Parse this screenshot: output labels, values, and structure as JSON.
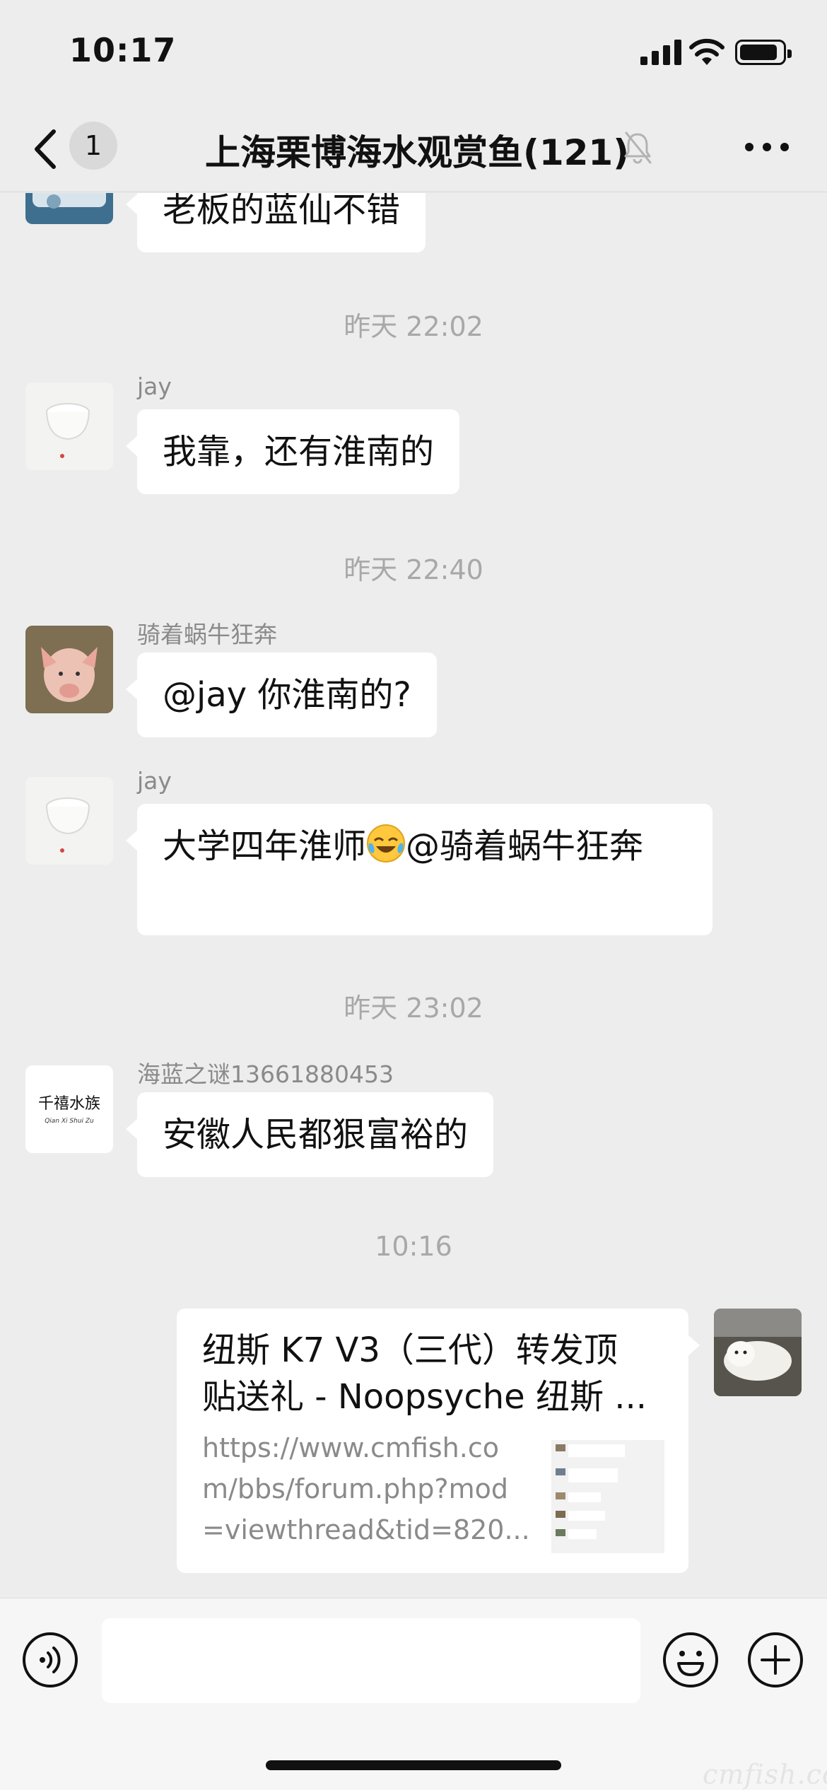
{
  "status_bar": {
    "time": "10:17"
  },
  "nav": {
    "back_icon": "chevron-left-icon",
    "unread_count": "1",
    "title": "上海栗博海水观赏鱼(121)",
    "mute_icon": "bell-slash-icon",
    "more_icon": "more-dots-icon"
  },
  "messages": {
    "partial": {
      "text": "老板的蓝仙不错"
    },
    "ts1": "昨天 22:02",
    "m1": {
      "sender": "jay",
      "text": "我靠，还有淮南的"
    },
    "ts2": "昨天 22:40",
    "m2": {
      "sender": "骑着蜗牛狂奔",
      "text": "@jay 你淮南的?"
    },
    "m3": {
      "sender": "jay",
      "text_before": "大学四年淮师",
      "emoji": "crying-laughing-emoji",
      "text_after": "@骑着蜗牛狂奔"
    },
    "ts3": "昨天 23:02",
    "m4": {
      "sender": "海蓝之谜13661880453",
      "avatar_text": "千禧水族",
      "avatar_subtext": "Qian Xi Shui Zu",
      "text": "安徽人民都狠富裕的"
    },
    "ts4": "10:16",
    "link": {
      "title_line1": "纽斯 K7 V3（三代）转发顶",
      "title_line2": "贴送礼 - Noopsyche 纽斯 ...",
      "url_line1": "https://www.cmfish.co",
      "url_line2": "m/bbs/forum.php?mod",
      "url_line3": "=viewthread&tid=820..."
    }
  },
  "input_bar": {
    "voice_icon": "voice-icon",
    "emoji_icon": "smiley-icon",
    "plus_icon": "plus-circle-icon",
    "placeholder": ""
  },
  "watermark": "cmfish.com",
  "colors": {
    "background": "#EDEDED",
    "bubble": "#FFFFFF",
    "timestamp": "#A8A8A8",
    "sender": "#8A8A8A"
  }
}
